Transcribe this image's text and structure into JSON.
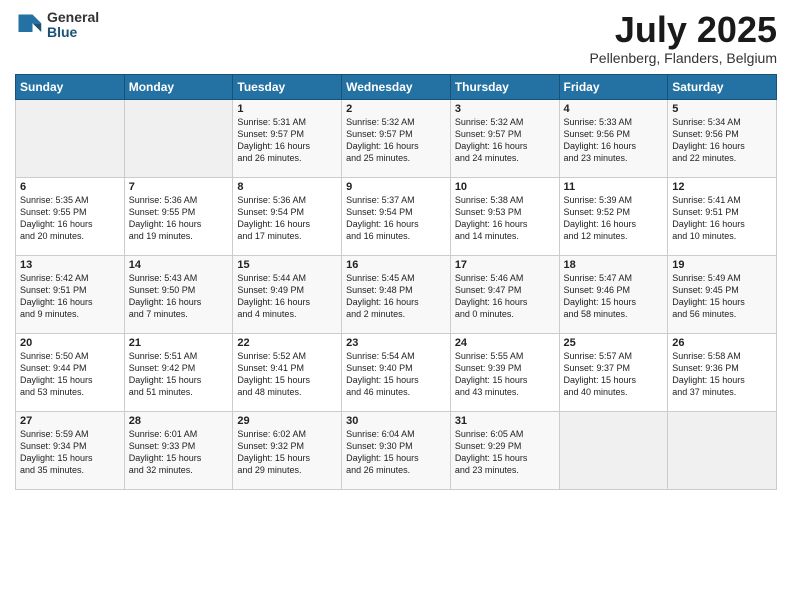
{
  "logo": {
    "general": "General",
    "blue": "Blue"
  },
  "header": {
    "month": "July 2025",
    "location": "Pellenberg, Flanders, Belgium"
  },
  "weekdays": [
    "Sunday",
    "Monday",
    "Tuesday",
    "Wednesday",
    "Thursday",
    "Friday",
    "Saturday"
  ],
  "weeks": [
    [
      {
        "day": "",
        "info": ""
      },
      {
        "day": "",
        "info": ""
      },
      {
        "day": "1",
        "info": "Sunrise: 5:31 AM\nSunset: 9:57 PM\nDaylight: 16 hours\nand 26 minutes."
      },
      {
        "day": "2",
        "info": "Sunrise: 5:32 AM\nSunset: 9:57 PM\nDaylight: 16 hours\nand 25 minutes."
      },
      {
        "day": "3",
        "info": "Sunrise: 5:32 AM\nSunset: 9:57 PM\nDaylight: 16 hours\nand 24 minutes."
      },
      {
        "day": "4",
        "info": "Sunrise: 5:33 AM\nSunset: 9:56 PM\nDaylight: 16 hours\nand 23 minutes."
      },
      {
        "day": "5",
        "info": "Sunrise: 5:34 AM\nSunset: 9:56 PM\nDaylight: 16 hours\nand 22 minutes."
      }
    ],
    [
      {
        "day": "6",
        "info": "Sunrise: 5:35 AM\nSunset: 9:55 PM\nDaylight: 16 hours\nand 20 minutes."
      },
      {
        "day": "7",
        "info": "Sunrise: 5:36 AM\nSunset: 9:55 PM\nDaylight: 16 hours\nand 19 minutes."
      },
      {
        "day": "8",
        "info": "Sunrise: 5:36 AM\nSunset: 9:54 PM\nDaylight: 16 hours\nand 17 minutes."
      },
      {
        "day": "9",
        "info": "Sunrise: 5:37 AM\nSunset: 9:54 PM\nDaylight: 16 hours\nand 16 minutes."
      },
      {
        "day": "10",
        "info": "Sunrise: 5:38 AM\nSunset: 9:53 PM\nDaylight: 16 hours\nand 14 minutes."
      },
      {
        "day": "11",
        "info": "Sunrise: 5:39 AM\nSunset: 9:52 PM\nDaylight: 16 hours\nand 12 minutes."
      },
      {
        "day": "12",
        "info": "Sunrise: 5:41 AM\nSunset: 9:51 PM\nDaylight: 16 hours\nand 10 minutes."
      }
    ],
    [
      {
        "day": "13",
        "info": "Sunrise: 5:42 AM\nSunset: 9:51 PM\nDaylight: 16 hours\nand 9 minutes."
      },
      {
        "day": "14",
        "info": "Sunrise: 5:43 AM\nSunset: 9:50 PM\nDaylight: 16 hours\nand 7 minutes."
      },
      {
        "day": "15",
        "info": "Sunrise: 5:44 AM\nSunset: 9:49 PM\nDaylight: 16 hours\nand 4 minutes."
      },
      {
        "day": "16",
        "info": "Sunrise: 5:45 AM\nSunset: 9:48 PM\nDaylight: 16 hours\nand 2 minutes."
      },
      {
        "day": "17",
        "info": "Sunrise: 5:46 AM\nSunset: 9:47 PM\nDaylight: 16 hours\nand 0 minutes."
      },
      {
        "day": "18",
        "info": "Sunrise: 5:47 AM\nSunset: 9:46 PM\nDaylight: 15 hours\nand 58 minutes."
      },
      {
        "day": "19",
        "info": "Sunrise: 5:49 AM\nSunset: 9:45 PM\nDaylight: 15 hours\nand 56 minutes."
      }
    ],
    [
      {
        "day": "20",
        "info": "Sunrise: 5:50 AM\nSunset: 9:44 PM\nDaylight: 15 hours\nand 53 minutes."
      },
      {
        "day": "21",
        "info": "Sunrise: 5:51 AM\nSunset: 9:42 PM\nDaylight: 15 hours\nand 51 minutes."
      },
      {
        "day": "22",
        "info": "Sunrise: 5:52 AM\nSunset: 9:41 PM\nDaylight: 15 hours\nand 48 minutes."
      },
      {
        "day": "23",
        "info": "Sunrise: 5:54 AM\nSunset: 9:40 PM\nDaylight: 15 hours\nand 46 minutes."
      },
      {
        "day": "24",
        "info": "Sunrise: 5:55 AM\nSunset: 9:39 PM\nDaylight: 15 hours\nand 43 minutes."
      },
      {
        "day": "25",
        "info": "Sunrise: 5:57 AM\nSunset: 9:37 PM\nDaylight: 15 hours\nand 40 minutes."
      },
      {
        "day": "26",
        "info": "Sunrise: 5:58 AM\nSunset: 9:36 PM\nDaylight: 15 hours\nand 37 minutes."
      }
    ],
    [
      {
        "day": "27",
        "info": "Sunrise: 5:59 AM\nSunset: 9:34 PM\nDaylight: 15 hours\nand 35 minutes."
      },
      {
        "day": "28",
        "info": "Sunrise: 6:01 AM\nSunset: 9:33 PM\nDaylight: 15 hours\nand 32 minutes."
      },
      {
        "day": "29",
        "info": "Sunrise: 6:02 AM\nSunset: 9:32 PM\nDaylight: 15 hours\nand 29 minutes."
      },
      {
        "day": "30",
        "info": "Sunrise: 6:04 AM\nSunset: 9:30 PM\nDaylight: 15 hours\nand 26 minutes."
      },
      {
        "day": "31",
        "info": "Sunrise: 6:05 AM\nSunset: 9:29 PM\nDaylight: 15 hours\nand 23 minutes."
      },
      {
        "day": "",
        "info": ""
      },
      {
        "day": "",
        "info": ""
      }
    ]
  ]
}
